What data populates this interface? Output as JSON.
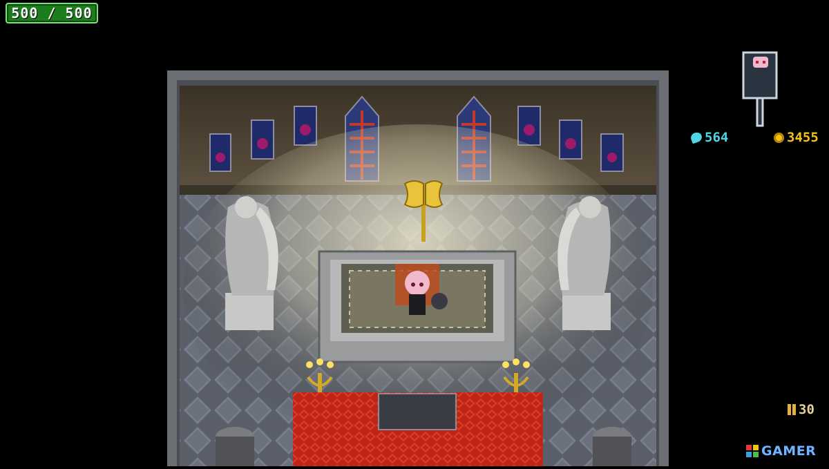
{
  "hud": {
    "hp_text": "500 / 500",
    "souls": "564",
    "gold": "3455",
    "ammo": "30"
  },
  "watermark": {
    "text": "GAMER"
  },
  "icons": {
    "souls": "soul-icon",
    "gold": "gold-coin-icon",
    "ammo": "ammo-icon"
  },
  "colors": {
    "hp_fill": "#1b7d1b",
    "souls": "#4fd6e6",
    "gold": "#f3c21b",
    "carpet": "#c0241a"
  },
  "scene": {
    "room": "chapel",
    "objects": [
      "golden-axe",
      "altar",
      "player-character",
      "angel-statue",
      "angel-statue",
      "candelabra",
      "candelabra",
      "stained-glass-window",
      "red-carpet",
      "stone-pillar",
      "stone-pillar"
    ]
  }
}
